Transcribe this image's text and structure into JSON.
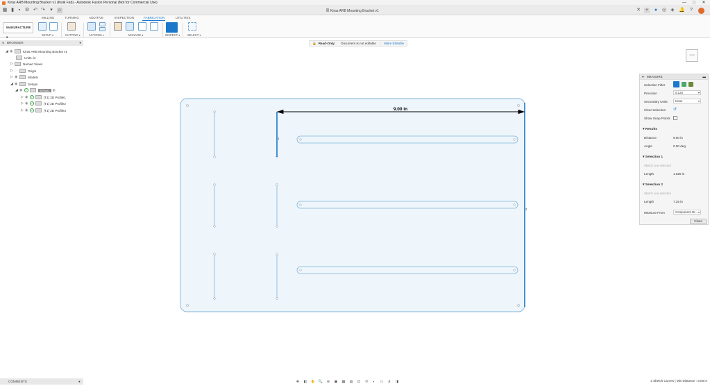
{
  "window": {
    "title": "Kiras ARB Mounting Bracket v1 (Kwik Fab) - Autodesk Fusion Personal (Not for Commercial Use)",
    "controls": [
      "—",
      "□",
      "✕"
    ]
  },
  "document_tab": "Kiras ARB Mounting Bracket v1",
  "ribbon": {
    "workspace": "MANUFACTURE",
    "tabs": [
      "MILLING",
      "TURNING",
      "ADDITIVE",
      "INSPECTION",
      "FABRICATION",
      "UTILITIES"
    ],
    "active_tab": "FABRICATION",
    "groups": [
      "SETUP",
      "CUTTING",
      "ACTIONS",
      "MANAGE",
      "INSPECT",
      "SELECT"
    ]
  },
  "browser": {
    "header": "BROWSER",
    "items": [
      {
        "label": "Kiras ARB Mounting Bracket v1"
      },
      {
        "label": "Units: in"
      },
      {
        "label": "Named Views"
      },
      {
        "label": "Origin"
      },
      {
        "label": "Models"
      },
      {
        "label": "Setups"
      },
      {
        "label": "Setup1"
      },
      {
        "label": "[T1] 2D Profile1"
      },
      {
        "label": "[T1] 2D Profile2"
      },
      {
        "label": "[T1] 2D Profile3"
      }
    ]
  },
  "banner": {
    "read_only": "Read-Only:",
    "message": "Document is not editable",
    "make_editable": "Make Editable"
  },
  "viewcube": {
    "label": "TOP"
  },
  "canvas": {
    "dimension_label": "9.00 in",
    "marker_1": "1",
    "marker_2": "2"
  },
  "measure": {
    "title": "MEASURE",
    "selection_filter": "Selection Filter",
    "precision_label": "Precision",
    "precision_value": "0.123",
    "secondary_units_label": "Secondary Units",
    "secondary_units_value": "None",
    "clear_selection": "Clear Selection",
    "show_snap_points": "Show Snap Points",
    "results": "Results",
    "distance_label": "Distance",
    "distance_value": "9.00 in",
    "angle_label": "Angle",
    "angle_value": "0.00 deg",
    "selection1": "Selection 1",
    "sel1_desc": "Sketch Line selected",
    "sel1_length_label": "Length",
    "sel1_length": "1.625 in",
    "selection2": "Selection 2",
    "sel2_desc": "Sketch Line selected",
    "sel2_length_label": "Length",
    "sel2_length": "7.25 in",
    "measure_from_label": "Measure From",
    "measure_from_value": "Component Or...",
    "close": "Close"
  },
  "comments": "COMMENTS",
  "status": "2 Sketch Curves | Min Distance : 9.00 in",
  "colors": {
    "accent": "#1a77c9",
    "sketch": "#7fb5d9"
  }
}
